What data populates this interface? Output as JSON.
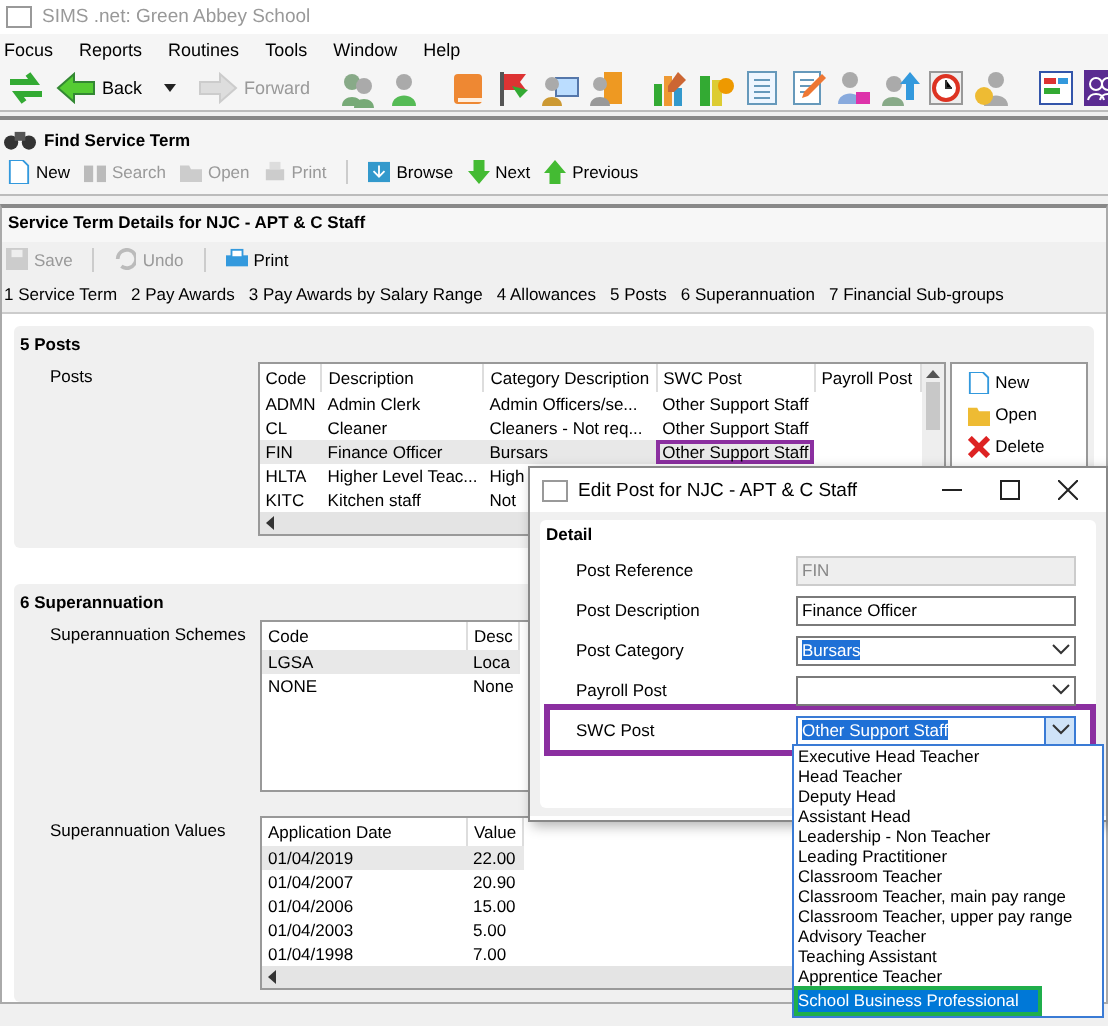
{
  "window": {
    "title": "SIMS .net: Green Abbey School"
  },
  "menu": [
    "Focus",
    "Reports",
    "Routines",
    "Tools",
    "Window",
    "Help"
  ],
  "nav": [
    {
      "label": "Back",
      "disabled": false,
      "has_menu": true
    },
    {
      "label": "Forward",
      "disabled": true,
      "has_menu": false
    }
  ],
  "find_panel": {
    "title": "Find Service Term",
    "buttons": [
      {
        "label": "New",
        "disabled": false
      },
      {
        "label": "Search",
        "disabled": true
      },
      {
        "label": "Open",
        "disabled": true
      },
      {
        "label": "Print",
        "disabled": true
      },
      {
        "label": "Browse",
        "disabled": false
      },
      {
        "label": "Next",
        "disabled": false
      },
      {
        "label": "Previous",
        "disabled": false
      }
    ]
  },
  "details": {
    "title": "Service Term Details for NJC - APT & C Staff",
    "buttons": [
      {
        "label": "Save",
        "disabled": true
      },
      {
        "label": "Undo",
        "disabled": true
      },
      {
        "label": "Print",
        "disabled": false
      }
    ],
    "tabs": [
      "1 Service Term",
      "2 Pay Awards",
      "3 Pay Awards by Salary Range",
      "4 Allowances",
      "5 Posts",
      "6 Superannuation",
      "7 Financial Sub-groups"
    ]
  },
  "posts": {
    "title": "5 Posts",
    "label": "Posts",
    "columns": [
      "Code",
      "Description",
      "Category Description",
      "SWC Post",
      "Payroll Post"
    ],
    "rows": [
      {
        "cells": [
          "ADMN",
          "Admin Clerk",
          "Admin Officers/se...",
          "Other Support Staff"
        ],
        "selected": false,
        "outlined": false
      },
      {
        "cells": [
          "CL",
          "Cleaner",
          "Cleaners - Not req...",
          "Other Support Staff"
        ],
        "selected": false,
        "outlined": false
      },
      {
        "cells": [
          "FIN",
          "Finance Officer",
          "Bursars",
          "Other Support Staff"
        ],
        "selected": true,
        "outlined": true
      },
      {
        "cells": [
          "HLTA",
          "Higher Level Teac...",
          "High"
        ],
        "selected": false,
        "outlined": false
      },
      {
        "cells": [
          "KITC",
          "Kitchen staff",
          "Not"
        ],
        "selected": false,
        "outlined": false
      }
    ],
    "buttons": [
      "New",
      "Open",
      "Delete"
    ]
  },
  "superannuation": {
    "title": "6 Superannuation",
    "schemes": {
      "label": "Superannuation Schemes",
      "columns": [
        "Code",
        "Desc"
      ],
      "rows": [
        {
          "cells": [
            "LGSA",
            "Loca"
          ],
          "selected": true
        },
        {
          "cells": [
            "NONE",
            "None"
          ],
          "selected": false
        }
      ]
    },
    "values": {
      "label": "Superannuation Values",
      "columns": [
        "Application Date",
        "Value"
      ],
      "rows": [
        {
          "cells": [
            "01/04/2019",
            "22.00"
          ],
          "selected": true
        },
        {
          "cells": [
            "01/04/2007",
            "20.90"
          ],
          "selected": false
        },
        {
          "cells": [
            "01/04/2006",
            "15.00"
          ],
          "selected": false
        },
        {
          "cells": [
            "01/04/2003",
            "5.00"
          ],
          "selected": false
        },
        {
          "cells": [
            "01/04/1998",
            "7.00"
          ],
          "selected": false
        }
      ]
    }
  },
  "dialog": {
    "title": "Edit Post for NJC - APT & C Staff",
    "group": "Detail",
    "fields": [
      {
        "label": "Post Reference",
        "value": "FIN",
        "kind": "text",
        "disabled": true,
        "highlighted": false,
        "outlined": false,
        "expanded": false
      },
      {
        "label": "Post Description",
        "value": "Finance Officer",
        "kind": "text",
        "disabled": false,
        "highlighted": false,
        "outlined": false,
        "expanded": false
      },
      {
        "label": "Post Category",
        "value": "Bursars",
        "kind": "dropdown",
        "disabled": false,
        "highlighted": true,
        "outlined": false,
        "expanded": false
      },
      {
        "label": "Payroll Post",
        "kind": "dropdown",
        "disabled": false,
        "highlighted": false,
        "outlined": false,
        "expanded": false
      },
      {
        "label": "SWC Post",
        "value": "Other Support Staff",
        "kind": "dropdown",
        "disabled": false,
        "highlighted": true,
        "outlined": true,
        "expanded": true
      }
    ],
    "options": [
      {
        "label": "Executive Head Teacher",
        "selected": false,
        "outlined": false
      },
      {
        "label": "Head Teacher",
        "selected": false,
        "outlined": false
      },
      {
        "label": "Deputy Head",
        "selected": false,
        "outlined": false
      },
      {
        "label": "Assistant Head",
        "selected": false,
        "outlined": false
      },
      {
        "label": "Leadership - Non Teacher",
        "selected": false,
        "outlined": false
      },
      {
        "label": "Leading Practitioner",
        "selected": false,
        "outlined": false
      },
      {
        "label": "Classroom Teacher",
        "selected": false,
        "outlined": false
      },
      {
        "label": "Classroom Teacher, main pay range",
        "selected": false,
        "outlined": false
      },
      {
        "label": "Classroom Teacher, upper pay range",
        "selected": false,
        "outlined": false
      },
      {
        "label": "Advisory Teacher",
        "selected": false,
        "outlined": false
      },
      {
        "label": "Teaching Assistant",
        "selected": false,
        "outlined": false
      },
      {
        "label": "Apprentice Teacher",
        "selected": false,
        "outlined": false
      },
      {
        "label": "School Business Professional",
        "selected": true,
        "outlined": true
      }
    ]
  }
}
